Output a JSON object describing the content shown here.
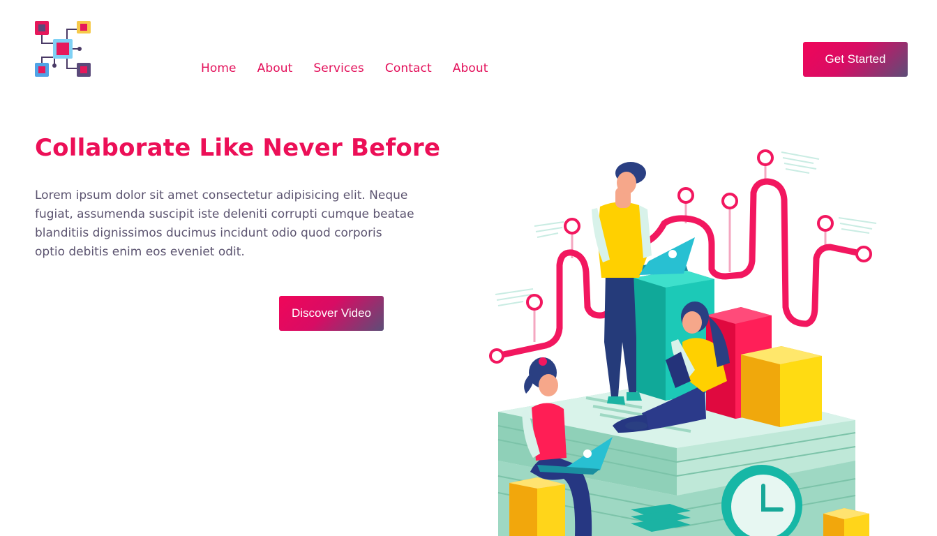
{
  "header": {
    "logo_icon": "circuit-chip-icon",
    "nav": [
      {
        "label": "Home"
      },
      {
        "label": "About"
      },
      {
        "label": "Services"
      },
      {
        "label": "Contact"
      },
      {
        "label": "About"
      }
    ],
    "cta_label": "Get Started"
  },
  "hero": {
    "title": "Collaborate Like Never Before",
    "paragraph": "Lorem ipsum dolor sit amet consectetur adipisicing elit. Neque fugiat, assumenda suscipit iste deleniti corrupti cumque beatae blanditiis dignissimos ducimus incidunt odio quod corporis optio debitis enim eos eveniet odit.",
    "video_button_label": "Discover Video",
    "illustration_icon": "team-collaboration-illustration"
  },
  "colors": {
    "accent": "#ec0f57",
    "button_gradient_start": "#f00659",
    "button_gradient_end": "#5c4e78",
    "body_text": "#5c5470"
  }
}
